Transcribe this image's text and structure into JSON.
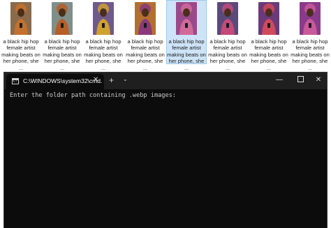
{
  "explorer": {
    "files": [
      {
        "label_line1": "a black hip hop",
        "label_line2": "female artist",
        "label_line3": "making beats on",
        "label_line4": "her phone, she ...",
        "selected": false,
        "bg": "#8a6a4a",
        "accent": "#c2722e",
        "icon": "portrait-thumbnail-icon"
      },
      {
        "label_line1": "a black hip hop",
        "label_line2": "female artist",
        "label_line3": "making beats on",
        "label_line4": "her phone, she ...",
        "selected": false,
        "bg": "#7f8f8a",
        "accent": "#b65f2a",
        "icon": "portrait-thumbnail-icon"
      },
      {
        "label_line1": "a black hip hop",
        "label_line2": "female artist",
        "label_line3": "making beats on",
        "label_line4": "her phone, she ...",
        "selected": false,
        "bg": "#6f5a8a",
        "accent": "#d0a030",
        "icon": "portrait-thumbnail-icon"
      },
      {
        "label_line1": "a black hip hop",
        "label_line2": "female artist",
        "label_line3": "making beats on",
        "label_line4": "her phone, she ...",
        "selected": false,
        "bg": "#b27030",
        "accent": "#8a3a7a",
        "icon": "portrait-thumbnail-icon"
      },
      {
        "label_line1": "a black hip hop",
        "label_line2": "female artist",
        "label_line3": "making beats on",
        "label_line4": "her phone, she ...",
        "selected": true,
        "bg": "#9a4a8a",
        "accent": "#d06a9a",
        "icon": "portrait-thumbnail-icon"
      },
      {
        "label_line1": "a black hip hop",
        "label_line2": "female artist",
        "label_line3": "making beats on",
        "label_line4": "her phone, she ...",
        "selected": false,
        "bg": "#5a4a7a",
        "accent": "#c44a7a",
        "icon": "portrait-thumbnail-icon"
      },
      {
        "label_line1": "a black hip hop",
        "label_line2": "female artist",
        "label_line3": "making beats on",
        "label_line4": "her phone, she ...",
        "selected": false,
        "bg": "#6a3a7a",
        "accent": "#d04a5a",
        "icon": "portrait-thumbnail-icon"
      },
      {
        "label_line1": "a black hip hop",
        "label_line2": "female artist",
        "label_line3": "making beats on",
        "label_line4": "her phone, she ...",
        "selected": false,
        "bg": "#8a3a8a",
        "accent": "#c85a9a",
        "icon": "portrait-thumbnail-icon"
      }
    ],
    "selection_color": "#cde3f7"
  },
  "terminal": {
    "tab_title": "C:\\WINDOWS\\system32\\cmd.",
    "tab_icon_glyph": "C:\\",
    "close_tab_glyph": "✕",
    "new_tab_glyph": "+",
    "dropdown_glyph": "⌄",
    "minimize_glyph": "—",
    "close_glyph": "✕",
    "prompt_text": "Enter the folder path containing .webp images:",
    "background": "#0c0c0c",
    "text_color": "#cccccc"
  }
}
